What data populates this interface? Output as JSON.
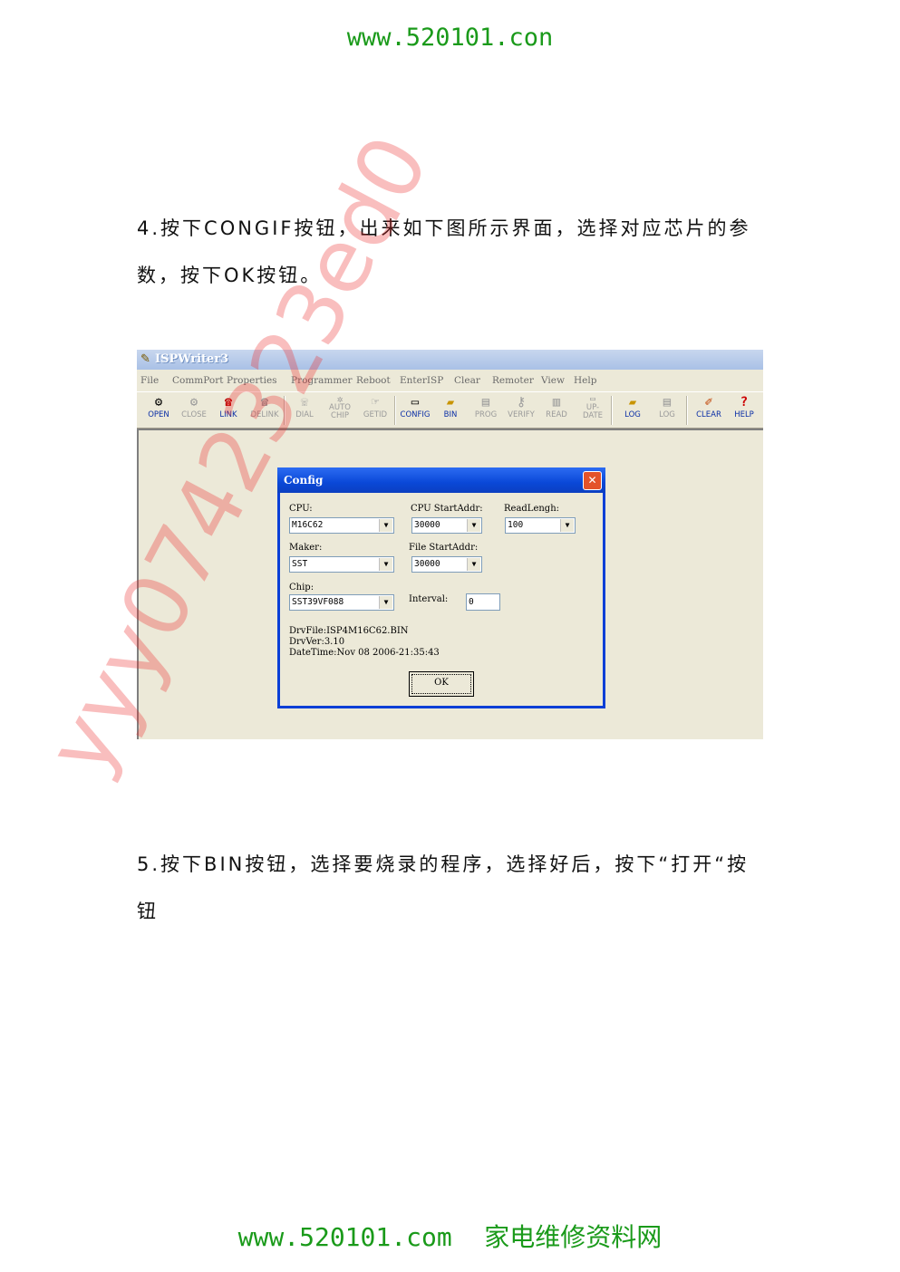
{
  "header": {
    "url": "www.520101.con"
  },
  "step4": {
    "line1": "4.按下CONGIF按钮，出来如下图所示界面，选择对应芯片的参",
    "line2": "数，按下OK按钮。"
  },
  "app": {
    "title": "ISPWriter3",
    "menu": [
      "File",
      "CommPort",
      "Properties",
      "Programmer",
      "Reboot",
      "EnterISP",
      "Clear",
      "Remoter",
      "View",
      "Help"
    ],
    "toolbar": [
      {
        "label": "OPEN",
        "icon": "open-icon"
      },
      {
        "label": "CLOSE",
        "icon": "close-port-icon"
      },
      {
        "label": "LINK",
        "icon": "phone-icon"
      },
      {
        "label": "DELINK",
        "icon": "delink-icon"
      },
      {
        "label": "DIAL",
        "icon": "dial-icon"
      },
      {
        "label": "AUTO CHIP",
        "icon": "autochip-icon"
      },
      {
        "label": "GETID",
        "icon": "getid-icon"
      },
      {
        "label": "CONFIG",
        "icon": "config-icon"
      },
      {
        "label": "BIN",
        "icon": "bin-folder-icon"
      },
      {
        "label": "PROG",
        "icon": "prog-icon"
      },
      {
        "label": "VERIFY",
        "icon": "verify-icon"
      },
      {
        "label": "READ",
        "icon": "read-icon"
      },
      {
        "label": "UP- DATE",
        "icon": "update-icon"
      },
      {
        "label": "LOG",
        "icon": "log-folder-icon"
      },
      {
        "label": "LOG",
        "icon": "log-icon"
      },
      {
        "label": "CLEAR",
        "icon": "broom-icon"
      },
      {
        "label": "HELP",
        "icon": "help-icon"
      }
    ]
  },
  "dialog": {
    "title": "Config",
    "close": "✕",
    "cpu_label": "CPU:",
    "cpu_value": "M16C62",
    "cpu_start_label": "CPU StartAddr:",
    "cpu_start_value": "30000",
    "readlen_label": "ReadLengh:",
    "readlen_value": "100",
    "maker_label": "Maker:",
    "maker_value": "SST",
    "file_start_label": "File StartAddr:",
    "file_start_value": "30000",
    "chip_label": "Chip:",
    "chip_value": "SST39VF088",
    "interval_label": "Interval:",
    "interval_value": "0",
    "drvfile": "DrvFile:ISP4M16C62.BIN",
    "drvver": "DrvVer:3.10",
    "datetime": "DateTime:Nov 08 2006-21:35:43",
    "ok": "OK"
  },
  "step5": {
    "line1": "5.按下BIN按钮，选择要烧录的程序，选择好后，按下“打开“按",
    "line2": "钮"
  },
  "watermark": "yyy0742323ed0",
  "footer": {
    "url": "www.520101.com",
    "site": "家电维修资料网"
  },
  "colors": {
    "green": "#1a9a1a",
    "xp_blue": "#0a48d8",
    "watermark": "#ec2828"
  }
}
